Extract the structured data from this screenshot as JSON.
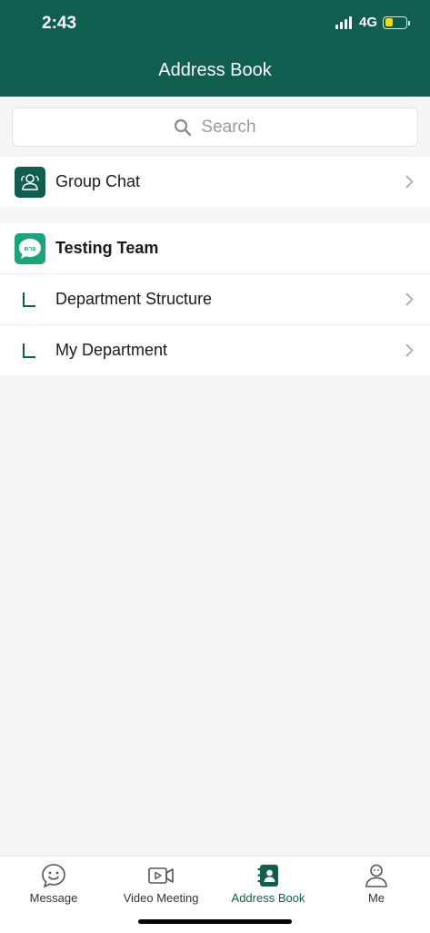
{
  "status_bar": {
    "time": "2:43",
    "network": "4G",
    "battery_level": 0.4
  },
  "header": {
    "title": "Address Book"
  },
  "search": {
    "placeholder": "Search"
  },
  "group_chat": {
    "label": "Group Chat"
  },
  "org": {
    "name": "Testing Team",
    "logo_text": "ดาอ",
    "items": [
      {
        "label": "Department Structure"
      },
      {
        "label": "My Department"
      }
    ]
  },
  "tabs": [
    {
      "label": "Message",
      "icon": "smile-chat-icon",
      "active": false
    },
    {
      "label": "Video Meeting",
      "icon": "video-icon",
      "active": false
    },
    {
      "label": "Address Book",
      "icon": "address-book-icon",
      "active": true
    },
    {
      "label": "Me",
      "icon": "person-icon",
      "active": false
    }
  ],
  "colors": {
    "primary": "#0f5e50",
    "accent_logo": "#17a57e",
    "background": "#f5f5f5"
  }
}
